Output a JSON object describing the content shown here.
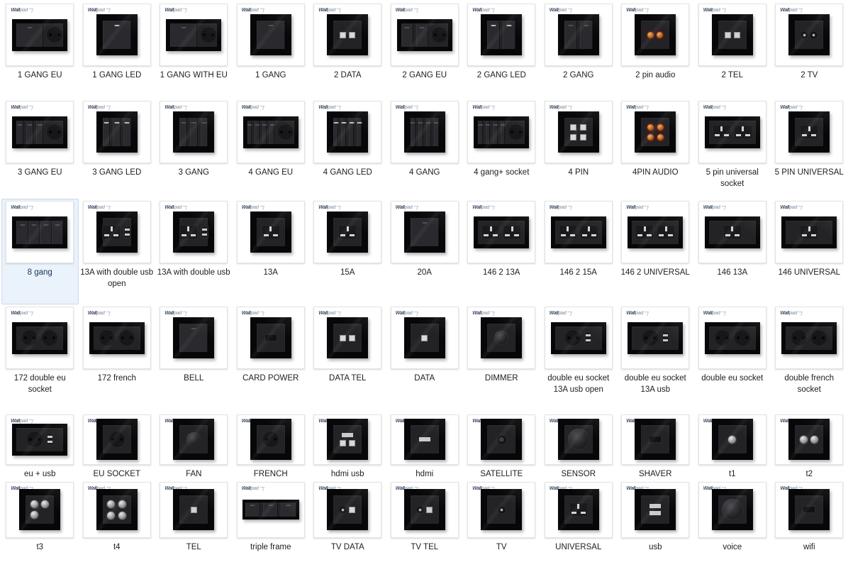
{
  "watermark": {
    "brand_dark": "Wall",
    "brand_light": "pad",
    "icon": "checkmark-tick-icon"
  },
  "selection": {
    "selected_label": "8 gang",
    "highlight_color": "#eaf2fb",
    "border_color": "#cdd9e8"
  },
  "grid": {
    "columns": 11,
    "rows": 6,
    "items": [
      {
        "label": "1 GANG EU",
        "art": "wide-key-eu"
      },
      {
        "label": "1 GANG LED",
        "art": "sq-key1-led"
      },
      {
        "label": "1 GANG WITH EU",
        "art": "wide-key-eu"
      },
      {
        "label": "1 GANG",
        "art": "sq-key1"
      },
      {
        "label": "2 DATA",
        "art": "sq-jack2"
      },
      {
        "label": "2 GANG EU",
        "art": "wide-key2-eu"
      },
      {
        "label": "2 GANG LED",
        "art": "sq-key2-led"
      },
      {
        "label": "2 GANG",
        "art": "sq-key2"
      },
      {
        "label": "2 pin audio",
        "art": "sq-audio2"
      },
      {
        "label": "2 TEL",
        "art": "sq-tel2"
      },
      {
        "label": "2 TV",
        "art": "sq-coax2"
      },
      {
        "label": "3 GANG EU",
        "art": "wide-key3-eu"
      },
      {
        "label": "3 GANG LED",
        "art": "sq-key3-led"
      },
      {
        "label": "3 GANG",
        "art": "sq-key3"
      },
      {
        "label": "4 GANG EU",
        "art": "wide-key4-eu"
      },
      {
        "label": "4 GANG LED",
        "art": "sq-key4-led"
      },
      {
        "label": "4 GANG",
        "art": "sq-key4"
      },
      {
        "label": "4 gang+ socket",
        "art": "wide-key4-eu"
      },
      {
        "label": "4 PIN",
        "art": "sq-pin4"
      },
      {
        "label": "4PIN AUDIO",
        "art": "sq-audio4"
      },
      {
        "label": "5 pin universal socket",
        "art": "wide-univ2"
      },
      {
        "label": "5 PIN UNIVERSAL",
        "art": "sq-univ"
      },
      {
        "label": "8 gang",
        "art": "wide-key8",
        "selected": true
      },
      {
        "label": "13A with double usb open",
        "art": "sq-uk-usb-open"
      },
      {
        "label": "13A with double usb",
        "art": "sq-uk-usb"
      },
      {
        "label": "13A",
        "art": "sq-uk"
      },
      {
        "label": "15A",
        "art": "sq-uk"
      },
      {
        "label": "20A",
        "art": "sq-key1"
      },
      {
        "label": "146 2 13A",
        "art": "wide-uk2"
      },
      {
        "label": "146 2 15A",
        "art": "wide-uk2"
      },
      {
        "label": "146 2 UNIVERSAL",
        "art": "wide-univ2"
      },
      {
        "label": "146 13A",
        "art": "wide-uk1"
      },
      {
        "label": "146 UNIVERSAL",
        "art": "wide-univ1"
      },
      {
        "label": "172 double eu socket",
        "art": "wide-eu2"
      },
      {
        "label": "172 french",
        "art": "wide-fr2"
      },
      {
        "label": "BELL",
        "art": "sq-key1"
      },
      {
        "label": "CARD POWER",
        "art": "sq-card"
      },
      {
        "label": "DATA TEL",
        "art": "sq-jack2"
      },
      {
        "label": "DATA",
        "art": "sq-jack1"
      },
      {
        "label": "DIMMER",
        "art": "sq-dimmer"
      },
      {
        "label": "double eu socket 13A usb open",
        "art": "wide-eu-usb"
      },
      {
        "label": "double eu socket 13A usb",
        "art": "wide-eu-usb"
      },
      {
        "label": "double eu socket",
        "art": "wide-eu2"
      },
      {
        "label": "double french socket",
        "art": "wide-fr2"
      },
      {
        "label": "eu + usb",
        "art": "wide-eu-usb"
      },
      {
        "label": "EU SOCKET",
        "art": "sq-eu1"
      },
      {
        "label": "FAN",
        "art": "sq-fan"
      },
      {
        "label": "FRENCH",
        "art": "sq-french"
      },
      {
        "label": "hdmi usb",
        "art": "sq-hdmi-usb"
      },
      {
        "label": "hdmi",
        "art": "sq-hdmi"
      },
      {
        "label": "SATELLITE",
        "art": "sq-sat"
      },
      {
        "label": "SENSOR",
        "art": "sq-sensor"
      },
      {
        "label": "SHAVER",
        "art": "sq-shaver"
      },
      {
        "label": "t1",
        "art": "sq-t1"
      },
      {
        "label": "t2",
        "art": "sq-t2"
      },
      {
        "label": "t3",
        "art": "sq-t3"
      },
      {
        "label": "t4",
        "art": "sq-t4"
      },
      {
        "label": "TEL",
        "art": "sq-tel1"
      },
      {
        "label": "triple frame",
        "art": "strip-frame3"
      },
      {
        "label": "TV DATA",
        "art": "sq-tv-data"
      },
      {
        "label": "TV TEL",
        "art": "sq-tv-tel"
      },
      {
        "label": "TV",
        "art": "sq-coax1"
      },
      {
        "label": "UNIVERSAL",
        "art": "sq-univ"
      },
      {
        "label": "usb",
        "art": "sq-usb2"
      },
      {
        "label": "voice",
        "art": "sq-voice"
      },
      {
        "label": "wifi",
        "art": "sq-wifi"
      }
    ]
  }
}
